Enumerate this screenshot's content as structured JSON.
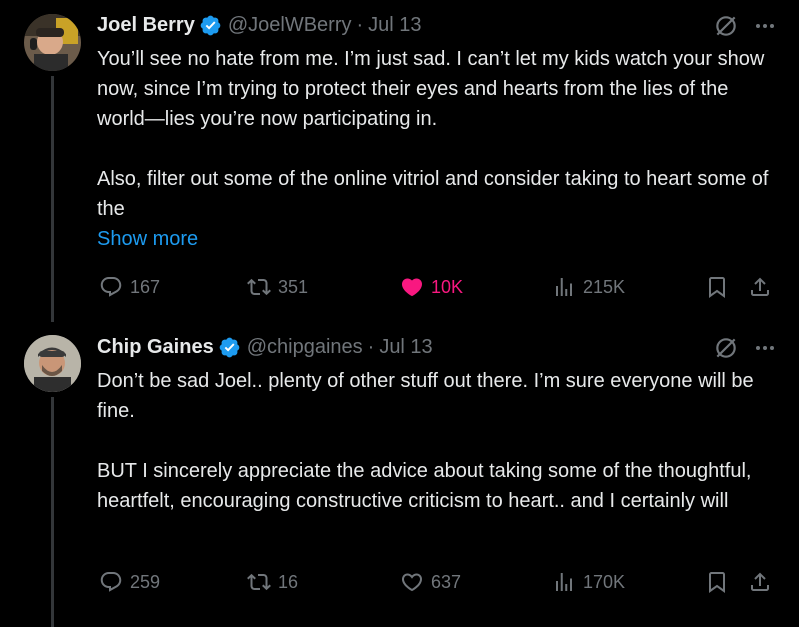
{
  "tweets": [
    {
      "author": "Joel Berry",
      "handle": "@JoelWBerry",
      "separator": "·",
      "date": "Jul 13",
      "paragraphs": [
        "You’ll see no hate from me. I’m just sad. I can’t let my kids watch your show now, since I’m trying to protect their eyes and hearts from the lies of the world—lies you’re now participating in.",
        "Also, filter out some of the online vitriol and consider taking to heart some of the"
      ],
      "show_more": "Show more",
      "replies": "167",
      "retweets": "351",
      "likes": "10K",
      "liked": true,
      "views": "215K"
    },
    {
      "author": "Chip Gaines",
      "handle": "@chipgaines",
      "separator": "·",
      "date": "Jul 13",
      "paragraphs": [
        "Don’t be sad Joel.. plenty of other stuff out there. I’m sure everyone will be fine.",
        "BUT I sincerely appreciate the advice about taking some of the thoughtful, heartfelt, encouraging constructive criticism to heart.. and I certainly will"
      ],
      "replies": "259",
      "retweets": "16",
      "likes": "637",
      "liked": false,
      "views": "170K"
    }
  ],
  "colors": {
    "background": "#000000",
    "text": "#e7e9ea",
    "secondary": "#71767b",
    "link": "#1d9bf0",
    "verified": "#1d9bf0",
    "like": "#f91880"
  },
  "icons": [
    "verified-badge-icon",
    "grok-icon",
    "more-icon",
    "reply-icon",
    "retweet-icon",
    "heart-icon",
    "views-icon",
    "bookmark-icon",
    "share-icon"
  ]
}
